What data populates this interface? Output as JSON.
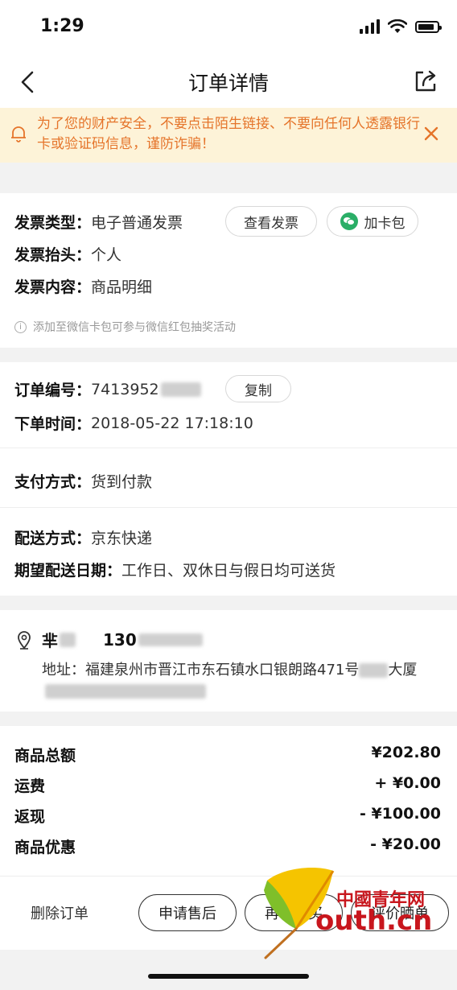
{
  "status": {
    "time": "1:29"
  },
  "nav": {
    "title": "订单详情"
  },
  "notice": {
    "text": "为了您的财产安全，不要点击陌生链接、不要向任何人透露银行卡或验证码信息，谨防诈骗！"
  },
  "invoice": {
    "type_label": "发票类型：",
    "type_value": "电子普通发票",
    "view_button": "查看发票",
    "card_button": "加卡包",
    "title_label": "发票抬头：",
    "title_value": "个人",
    "content_label": "发票内容：",
    "content_value": "商品明细",
    "info": "添加至微信卡包可参与微信红包抽奖活动"
  },
  "order": {
    "number_label": "订单编号：",
    "number_value": "7413952",
    "copy_button": "复制",
    "time_label": "下单时间：",
    "time_value": "2018-05-22 17:18:10"
  },
  "payment": {
    "label": "支付方式：",
    "value": "货到付款"
  },
  "delivery": {
    "method_label": "配送方式：",
    "method_value": "京东快递",
    "date_label": "期望配送日期：",
    "date_value": "工作日、双休日与假日均可送货"
  },
  "address": {
    "name": "芈",
    "phone": "130",
    "address_prefix": "地址：福建泉州市晋江市东石镇水口银朗路471号",
    "address_suffix": "大厦"
  },
  "prices": [
    {
      "label": "商品总额",
      "amount": "¥202.80"
    },
    {
      "label": "运费",
      "amount": "+ ¥0.00"
    },
    {
      "label": "返现",
      "amount": "- ¥100.00"
    },
    {
      "label": "商品优惠",
      "amount": "- ¥20.00"
    }
  ],
  "bottom": {
    "delete": "删除订单",
    "after_sale": "申请售后",
    "rebuy": "再次购买",
    "review": "评价晒单"
  },
  "watermark": {
    "cn": "中國青年网",
    "url": "outh.cn"
  }
}
